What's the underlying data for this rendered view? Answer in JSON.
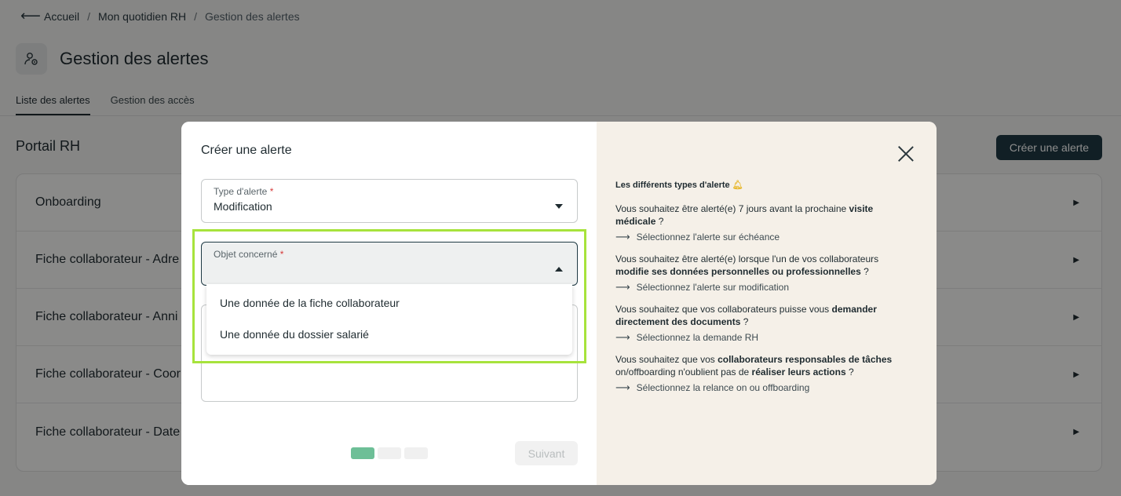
{
  "breadcrumb": {
    "back_icon": "arrow-left-icon",
    "items": [
      "Accueil",
      "Mon quotidien RH",
      "Gestion des alertes"
    ],
    "separator": "/"
  },
  "page": {
    "title": "Gestion des alertes",
    "icon": "alert-settings-icon",
    "tabs": [
      {
        "label": "Liste des alertes",
        "active": true
      },
      {
        "label": "Gestion des accès",
        "active": false
      }
    ],
    "section_title": "Portail RH",
    "create_button": "Créer une alerte",
    "rows": [
      "Onboarding",
      "Fiche collaborateur - Adre",
      "Fiche collaborateur - Anni",
      "Fiche collaborateur - Coor",
      "Fiche collaborateur - Date"
    ]
  },
  "modal": {
    "title": "Créer une alerte",
    "type_field": {
      "label": "Type d'alerte",
      "required_mark": "*",
      "value": "Modification"
    },
    "object_field": {
      "label": "Objet concerné",
      "required_mark": "*",
      "value": ""
    },
    "options": [
      "Une donnée de la fiche collaborateur",
      "Une donnée du dossier salarié"
    ],
    "steps": {
      "total": 3,
      "current": 1
    },
    "next_button": "Suivant"
  },
  "info": {
    "title": "Les différents types d'alerte",
    "title_icon": "bell-icon",
    "blocks": [
      {
        "parts": [
          "Vous souhaitez être alerté(e) 7 jours avant la prochaine ",
          "visite médicale",
          " ?"
        ],
        "link": "Sélectionnez l'alerte sur échéance"
      },
      {
        "parts": [
          "Vous souhaitez être alerté(e) lorsque l'un de vos collaborateurs ",
          "modifie ses données personnelles ou professionnelles",
          " ?"
        ],
        "link": "Sélectionnez l'alerte sur modification"
      },
      {
        "parts": [
          "Vous souhaitez que vos collaborateurs puisse vous ",
          "demander directement des documents",
          " ?"
        ],
        "link": "Sélectionnez la demande RH"
      },
      {
        "parts": [
          "Vous souhaitez que vos ",
          "collaborateurs responsables de tâches",
          " on/offboarding n'oublient pas de ",
          "réaliser leurs actions",
          " ?"
        ],
        "link": "Sélectionnez la relance on ou offboarding"
      }
    ]
  },
  "colors": {
    "primary": "#1f3a44",
    "highlight": "#a7e33c",
    "step_active": "#6dbf97",
    "required": "#d63a3a",
    "info_panel": "#f5f0e8"
  }
}
